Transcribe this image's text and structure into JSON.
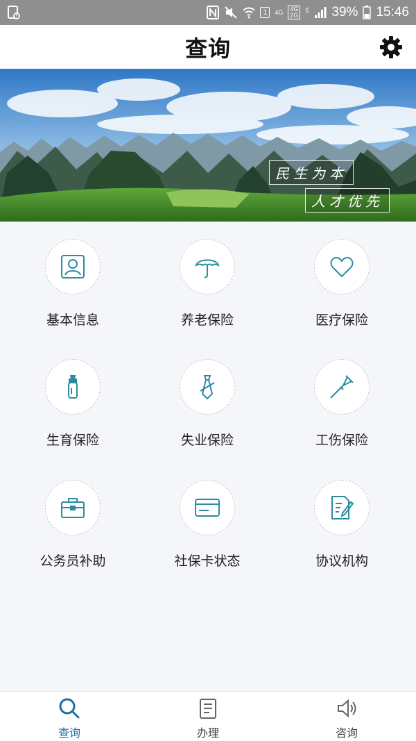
{
  "status_bar": {
    "network_gen": "4G",
    "network_stack_top": "4G",
    "network_stack_bottom": "2G",
    "edge_label": "E",
    "sim_badge": "1",
    "battery": "39%",
    "time": "15:46",
    "icons": [
      "sim-card-icon",
      "nfc-icon",
      "mute-icon",
      "wifi-icon",
      "signal-icon",
      "battery-icon"
    ]
  },
  "header": {
    "title": "查询",
    "settings_icon": "gear-icon"
  },
  "banner": {
    "caption_line1": "民生为本",
    "caption_line2": "人才优先"
  },
  "menu": {
    "items": [
      {
        "label": "基本信息",
        "icon": "id-card-icon"
      },
      {
        "label": "养老保险",
        "icon": "umbrella-icon"
      },
      {
        "label": "医疗保险",
        "icon": "heart-icon"
      },
      {
        "label": "生育保险",
        "icon": "baby-bottle-icon"
      },
      {
        "label": "失业保险",
        "icon": "tie-icon"
      },
      {
        "label": "工伤保险",
        "icon": "crutch-icon"
      },
      {
        "label": "公务员补助",
        "icon": "briefcase-icon"
      },
      {
        "label": "社保卡状态",
        "icon": "card-icon"
      },
      {
        "label": "协议机构",
        "icon": "document-edit-icon"
      }
    ]
  },
  "tabs": [
    {
      "label": "查询",
      "icon": "search-icon",
      "active": true
    },
    {
      "label": "办理",
      "icon": "clipboard-icon",
      "active": false
    },
    {
      "label": "咨询",
      "icon": "speaker-icon",
      "active": false
    }
  ],
  "colors": {
    "accent": "#1b6fa0",
    "icon_teal": "#2a8aa0",
    "background": "#f4f6fa",
    "status_bar": "#8f8f8f"
  }
}
